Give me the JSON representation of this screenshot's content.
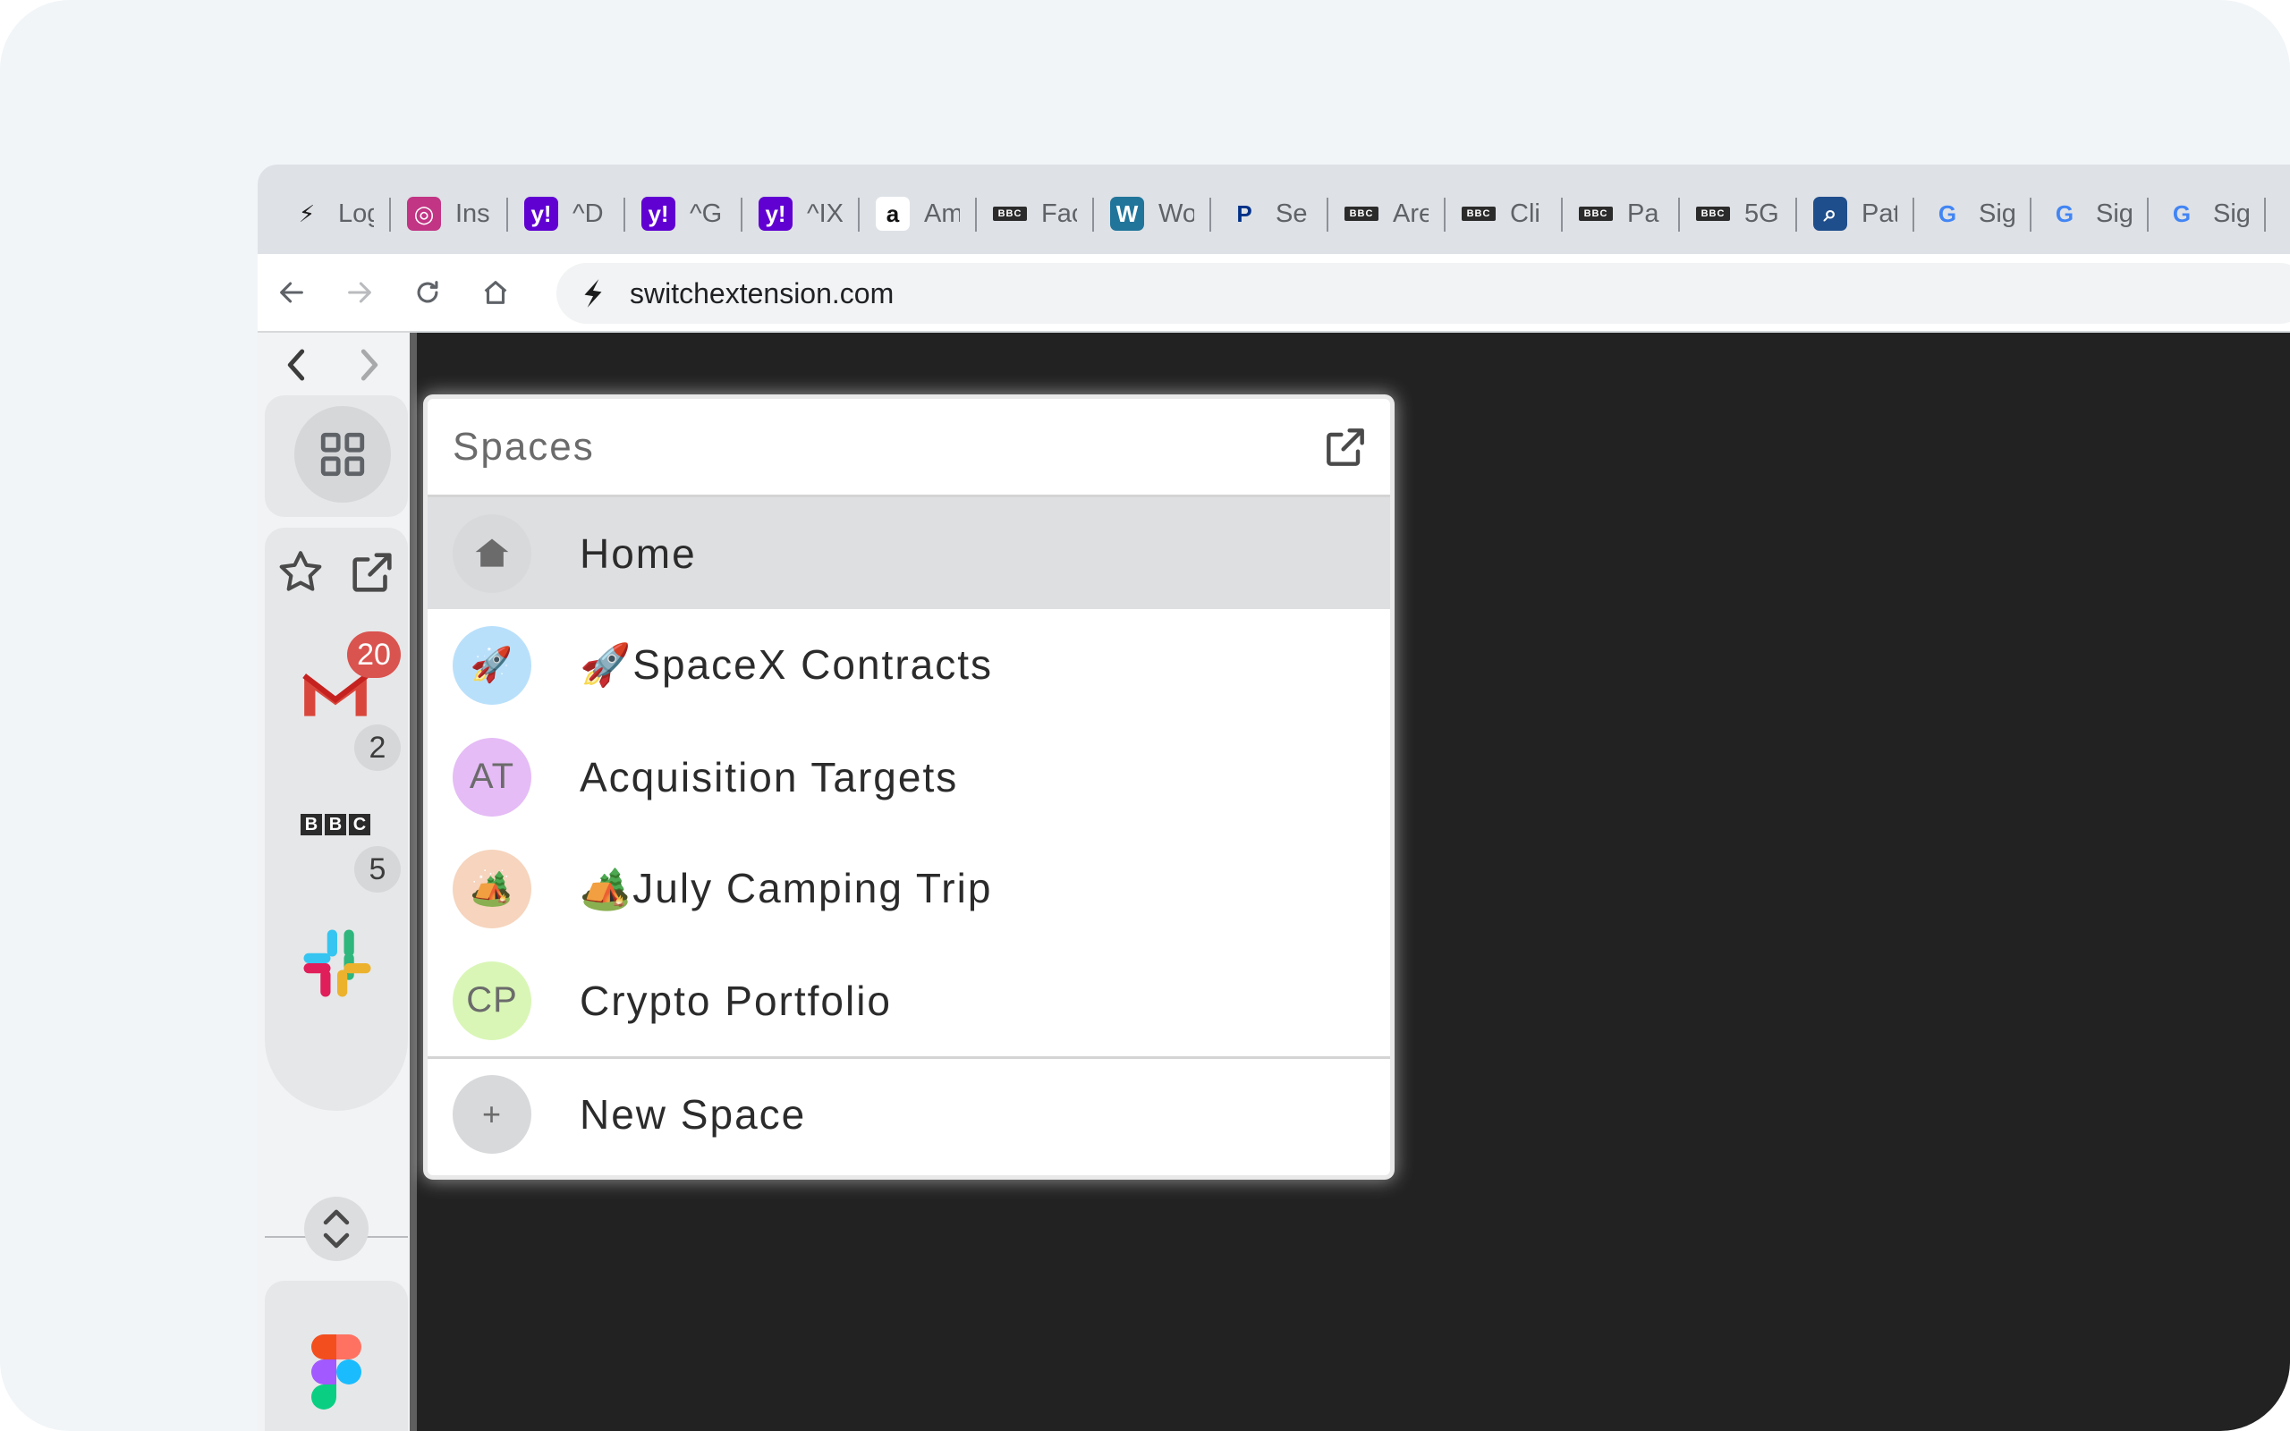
{
  "tabs": [
    {
      "title": "Log",
      "icon": "bolt-icon",
      "bg": "#dee1e6",
      "glyph": "⚡",
      "color": "#1c1c1c"
    },
    {
      "title": "Ins",
      "icon": "instagram-icon",
      "bg": "#c13584",
      "glyph": "◎",
      "color": "#ffffff"
    },
    {
      "title": "^D",
      "icon": "yahoo-icon",
      "bg": "#6001d2",
      "glyph": "y!",
      "color": "#ffffff"
    },
    {
      "title": "^G",
      "icon": "yahoo-icon",
      "bg": "#6001d2",
      "glyph": "y!",
      "color": "#ffffff"
    },
    {
      "title": "^IX",
      "icon": "yahoo-icon",
      "bg": "#6001d2",
      "glyph": "y!",
      "color": "#ffffff"
    },
    {
      "title": "Am",
      "icon": "amazon-icon",
      "bg": "#ffffff",
      "glyph": "a",
      "color": "#111111"
    },
    {
      "title": "Fac",
      "icon": "bbc-icon",
      "bg": "#dee1e6",
      "glyph": "BBC",
      "color": "#111111"
    },
    {
      "title": "Wo",
      "icon": "wordpress-icon",
      "bg": "#21759b",
      "glyph": "W",
      "color": "#ffffff"
    },
    {
      "title": "Se",
      "icon": "paypal-icon",
      "bg": "#dee1e6",
      "glyph": "P",
      "color": "#003087"
    },
    {
      "title": "Are",
      "icon": "bbc-icon",
      "bg": "#dee1e6",
      "glyph": "BBC",
      "color": "#111111"
    },
    {
      "title": "Cli",
      "icon": "bbc-icon",
      "bg": "#dee1e6",
      "glyph": "BBC",
      "color": "#111111"
    },
    {
      "title": "Pa",
      "icon": "bbc-icon",
      "bg": "#dee1e6",
      "glyph": "BBC",
      "color": "#111111"
    },
    {
      "title": "5G",
      "icon": "bbc-icon",
      "bg": "#dee1e6",
      "glyph": "BBC",
      "color": "#111111"
    },
    {
      "title": "Pat",
      "icon": "search-icon",
      "bg": "#1f4e8c",
      "glyph": "⌕",
      "color": "#ffffff"
    },
    {
      "title": "Sig",
      "icon": "google-icon",
      "bg": "#dee1e6",
      "glyph": "G",
      "color": "#4285f4"
    },
    {
      "title": "Sig",
      "icon": "google-icon",
      "bg": "#dee1e6",
      "glyph": "G",
      "color": "#4285f4"
    },
    {
      "title": "Sig",
      "icon": "google-icon",
      "bg": "#dee1e6",
      "glyph": "G",
      "color": "#4285f4"
    }
  ],
  "toolbar": {
    "url": "switchextension.com"
  },
  "sidebar": {
    "gmail_unread": "20",
    "gmail_count": "2",
    "bbc_count": "5"
  },
  "spaces_panel": {
    "title": "Spaces",
    "items": [
      {
        "label": "Home",
        "avatar": "",
        "avatar_bg": "#d8d9db",
        "icon": "home-icon"
      },
      {
        "label": "🚀SpaceX Contracts",
        "avatar": "🚀",
        "avatar_bg": "#b9e0fb",
        "icon": "rocket-icon"
      },
      {
        "label": "Acquisition Targets",
        "avatar": "AT",
        "avatar_bg": "#e5bcf6",
        "icon": ""
      },
      {
        "label": "🏕️July Camping Trip",
        "avatar": "🏕️",
        "avatar_bg": "#f6d4bd",
        "icon": "tent-icon"
      },
      {
        "label": "Crypto Portfolio",
        "avatar": "CP",
        "avatar_bg": "#d9f6b6",
        "icon": ""
      }
    ],
    "new_space_label": "New Space",
    "new_space_glyph": "+"
  }
}
